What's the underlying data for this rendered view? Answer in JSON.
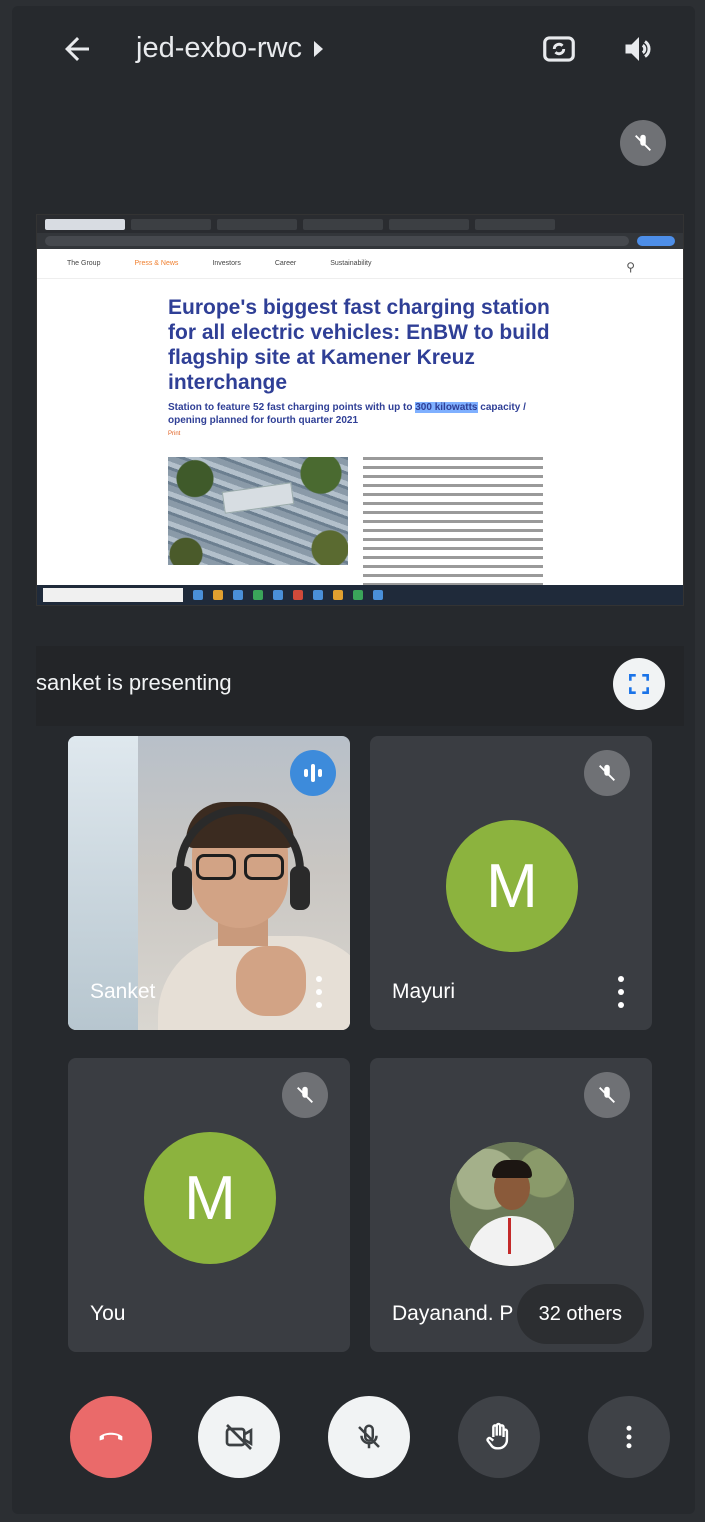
{
  "header": {
    "meeting_code": "jed-exbo-rwc",
    "icons": [
      "back-arrow-icon",
      "switch-camera-icon",
      "speaker-icon"
    ]
  },
  "presentation": {
    "presenter_label": "sanket is presenting",
    "shared_screen": {
      "site_nav": [
        "The Group",
        "Press & News",
        "Investors",
        "Career",
        "Sustainability"
      ],
      "article_title": "Europe's biggest fast charging station for all electric vehicles: EnBW to build flagship site at Kamener Kreuz interchange",
      "article_subtitle_a": "Station to feature 52 fast charging points with up to",
      "article_subtitle_highlight": "300 kilowatts",
      "article_subtitle_b": "capacity / opening planned for fourth quarter 2021",
      "print_label": "Print"
    }
  },
  "participants": [
    {
      "name": "Sanket",
      "status": "speaking",
      "avatar": "video"
    },
    {
      "name": "Mayuri",
      "status": "muted",
      "avatar": "M",
      "avatar_color": "#8cb33e"
    },
    {
      "name": "You",
      "status": "muted",
      "avatar": "M",
      "avatar_color": "#8cb33e"
    },
    {
      "name": "Dayanand. P",
      "status": "muted",
      "avatar": "photo",
      "others_label": "32 others"
    }
  ],
  "controls": {
    "buttons": [
      "end-call",
      "camera-off",
      "mic-off",
      "raise-hand",
      "more-options"
    ],
    "end_call_color": "#ea6a6a"
  }
}
